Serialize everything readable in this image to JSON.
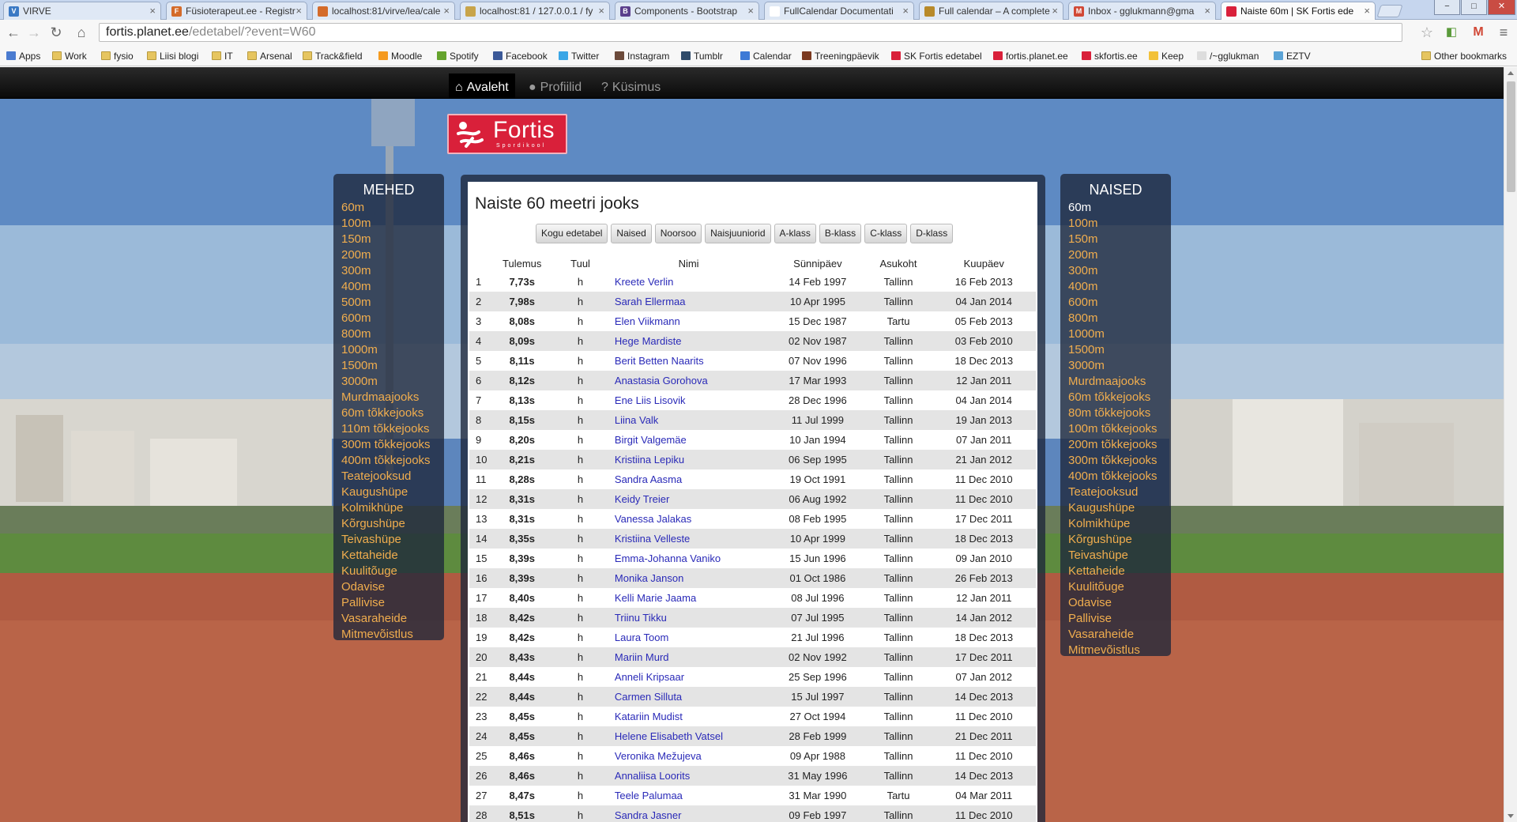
{
  "browser": {
    "tabs": [
      {
        "title": "VIRVE",
        "fav": "V",
        "color": "#3a79c4"
      },
      {
        "title": "Füsioterapeut.ee - Registr",
        "fav": "F",
        "color": "#d46b2a"
      },
      {
        "title": "localhost:81/virve/lea/cale",
        "fav": "",
        "color": "#d46b2a"
      },
      {
        "title": "localhost:81 / 127.0.0.1 / fy",
        "fav": "",
        "color": "#c8a44a"
      },
      {
        "title": "Components - Bootstrap",
        "fav": "B",
        "color": "#5b3f8c"
      },
      {
        "title": "FullCalendar Documentati",
        "fav": "",
        "color": "#ffffff"
      },
      {
        "title": "Full calendar – A complete",
        "fav": "",
        "color": "#b88a2a"
      },
      {
        "title": "Inbox - gglukmann@gma",
        "fav": "M",
        "color": "#d14836"
      },
      {
        "title": "Naiste 60m | SK Fortis ede",
        "fav": "",
        "color": "#d9203a"
      }
    ],
    "url_host": "fortis.planet.ee",
    "url_path": "/edetabel/?event=W60",
    "bookmarks": [
      {
        "label": "Apps",
        "icon": "apps-icon"
      },
      {
        "label": "Work",
        "icon": "folder-icon"
      },
      {
        "label": "fysio",
        "icon": "folder-icon"
      },
      {
        "label": "Liisi blogi",
        "icon": "folder-icon"
      },
      {
        "label": "IT",
        "icon": "folder-icon"
      },
      {
        "label": "Arsenal",
        "icon": "folder-icon"
      },
      {
        "label": "Track&field",
        "icon": "folder-icon"
      },
      {
        "label": "Moodle",
        "icon": "moodle-icon"
      },
      {
        "label": "Spotify",
        "icon": "spotify-icon"
      },
      {
        "label": "Facebook",
        "icon": "facebook-icon"
      },
      {
        "label": "Twitter",
        "icon": "twitter-icon"
      },
      {
        "label": "Instagram",
        "icon": "instagram-icon"
      },
      {
        "label": "Tumblr",
        "icon": "tumblr-icon"
      },
      {
        "label": "Calendar",
        "icon": "calendar-icon"
      },
      {
        "label": "Treeningpäevik",
        "icon": "shoe-icon"
      },
      {
        "label": "SK Fortis edetabel",
        "icon": "fortis-icon"
      },
      {
        "label": "fortis.planet.ee",
        "icon": "fortis-icon"
      },
      {
        "label": "skfortis.ee",
        "icon": "fortis-icon"
      },
      {
        "label": "Keep",
        "icon": "keep-icon"
      },
      {
        "label": "/~gglukman",
        "icon": "page-icon"
      },
      {
        "label": "EZTV",
        "icon": "eztv-icon"
      }
    ],
    "other_bookmarks": "Other bookmarks"
  },
  "nav": {
    "items": [
      {
        "label": "Avaleht",
        "icon": "home-icon",
        "active": true
      },
      {
        "label": "Profiilid",
        "icon": "user-icon",
        "active": false
      },
      {
        "label": "Küsimus",
        "icon": "question-icon",
        "active": false
      }
    ]
  },
  "logo": {
    "name": "Fortis",
    "sub": "Spordikool"
  },
  "left": {
    "title": "MEHED",
    "events": [
      "60m",
      "100m",
      "150m",
      "200m",
      "300m",
      "400m",
      "500m",
      "600m",
      "800m",
      "1000m",
      "1500m",
      "3000m",
      "Murdmaajooks",
      "60m tõkkejooks",
      "110m tõkkejooks",
      "300m tõkkejooks",
      "400m tõkkejooks",
      "Teatejooksud",
      "Kaugushüpe",
      "Kolmikhüpe",
      "Kõrgushüpe",
      "Teivashüpe",
      "Kettaheide",
      "Kuulitõuge",
      "Odavise",
      "Pallivise",
      "Vasaraheide",
      "Mitmevõistlus"
    ]
  },
  "right": {
    "title": "NAISED",
    "selected": "60m",
    "events": [
      "60m",
      "100m",
      "150m",
      "200m",
      "300m",
      "400m",
      "600m",
      "800m",
      "1000m",
      "1500m",
      "3000m",
      "Murdmaajooks",
      "60m tõkkejooks",
      "80m tõkkejooks",
      "100m tõkkejooks",
      "200m tõkkejooks",
      "300m tõkkejooks",
      "400m tõkkejooks",
      "Teatejooksud",
      "Kaugushüpe",
      "Kolmikhüpe",
      "Kõrgushüpe",
      "Teivashüpe",
      "Kettaheide",
      "Kuulitõuge",
      "Odavise",
      "Pallivise",
      "Vasaraheide",
      "Mitmevõistlus"
    ]
  },
  "main": {
    "title": "Naiste 60 meetri jooks",
    "filters": [
      "Kogu edetabel",
      "Naised",
      "Noorsoo",
      "Naisjuuniorid",
      "A-klass",
      "B-klass",
      "C-klass",
      "D-klass"
    ],
    "columns": [
      "",
      "Tulemus",
      "Tuul",
      "Nimi",
      "Sünnipäev",
      "Asukoht",
      "Kuupäev"
    ],
    "rows": [
      [
        "1",
        "7,73s",
        "h",
        "Kreete Verlin",
        "14 Feb 1997",
        "Tallinn",
        "16 Feb 2013"
      ],
      [
        "2",
        "7,98s",
        "h",
        "Sarah Ellermaa",
        "10 Apr 1995",
        "Tallinn",
        "04 Jan 2014"
      ],
      [
        "3",
        "8,08s",
        "h",
        "Elen Viikmann",
        "15 Dec 1987",
        "Tartu",
        "05 Feb 2013"
      ],
      [
        "4",
        "8,09s",
        "h",
        "Hege Mardiste",
        "02 Nov 1987",
        "Tallinn",
        "03 Feb 2010"
      ],
      [
        "5",
        "8,11s",
        "h",
        "Berit Betten Naarits",
        "07 Nov 1996",
        "Tallinn",
        "18 Dec 2013"
      ],
      [
        "6",
        "8,12s",
        "h",
        "Anastasia Gorohova",
        "17 Mar 1993",
        "Tallinn",
        "12 Jan 2011"
      ],
      [
        "7",
        "8,13s",
        "h",
        "Ene Liis Lisovik",
        "28 Dec 1996",
        "Tallinn",
        "04 Jan 2014"
      ],
      [
        "8",
        "8,15s",
        "h",
        "Liina Valk",
        "11 Jul 1999",
        "Tallinn",
        "19 Jan 2013"
      ],
      [
        "9",
        "8,20s",
        "h",
        "Birgit Valgemäe",
        "10 Jan 1994",
        "Tallinn",
        "07 Jan 2011"
      ],
      [
        "10",
        "8,21s",
        "h",
        "Kristiina Lepiku",
        "06 Sep 1995",
        "Tallinn",
        "21 Jan 2012"
      ],
      [
        "11",
        "8,28s",
        "h",
        "Sandra Aasma",
        "19 Oct 1991",
        "Tallinn",
        "11 Dec 2010"
      ],
      [
        "12",
        "8,31s",
        "h",
        "Keidy Treier",
        "06 Aug 1992",
        "Tallinn",
        "11 Dec 2010"
      ],
      [
        "13",
        "8,31s",
        "h",
        "Vanessa Jalakas",
        "08 Feb 1995",
        "Tallinn",
        "17 Dec 2011"
      ],
      [
        "14",
        "8,35s",
        "h",
        "Kristiina Velleste",
        "10 Apr 1999",
        "Tallinn",
        "18 Dec 2013"
      ],
      [
        "15",
        "8,39s",
        "h",
        "Emma-Johanna Vaniko",
        "15 Jun 1996",
        "Tallinn",
        "09 Jan 2010"
      ],
      [
        "16",
        "8,39s",
        "h",
        "Monika Janson",
        "01 Oct 1986",
        "Tallinn",
        "26 Feb 2013"
      ],
      [
        "17",
        "8,40s",
        "h",
        "Kelli Marie Jaama",
        "08 Jul 1996",
        "Tallinn",
        "12 Jan 2011"
      ],
      [
        "18",
        "8,42s",
        "h",
        "Triinu Tikku",
        "07 Jul 1995",
        "Tallinn",
        "14 Jan 2012"
      ],
      [
        "19",
        "8,42s",
        "h",
        "Laura Toom",
        "21 Jul 1996",
        "Tallinn",
        "18 Dec 2013"
      ],
      [
        "20",
        "8,43s",
        "h",
        "Mariin Murd",
        "02 Nov 1992",
        "Tallinn",
        "17 Dec 2011"
      ],
      [
        "21",
        "8,44s",
        "h",
        "Anneli Kripsaar",
        "25 Sep 1996",
        "Tallinn",
        "07 Jan 2012"
      ],
      [
        "22",
        "8,44s",
        "h",
        "Carmen Silluta",
        "15 Jul 1997",
        "Tallinn",
        "14 Dec 2013"
      ],
      [
        "23",
        "8,45s",
        "h",
        "Katariin Mudist",
        "27 Oct 1994",
        "Tallinn",
        "11 Dec 2010"
      ],
      [
        "24",
        "8,45s",
        "h",
        "Helene Elisabeth Vatsel",
        "28 Feb 1999",
        "Tallinn",
        "21 Dec 2011"
      ],
      [
        "25",
        "8,46s",
        "h",
        "Veronika Mežujeva",
        "09 Apr 1988",
        "Tallinn",
        "11 Dec 2010"
      ],
      [
        "26",
        "8,46s",
        "h",
        "Annaliisa Loorits",
        "31 May 1996",
        "Tallinn",
        "14 Dec 2013"
      ],
      [
        "27",
        "8,47s",
        "h",
        "Teele Palumaa",
        "31 Mar 1990",
        "Tartu",
        "04 Mar 2011"
      ],
      [
        "28",
        "8,51s",
        "h",
        "Sandra Jasner",
        "09 Feb 1997",
        "Tallinn",
        "11 Dec 2010"
      ]
    ]
  }
}
